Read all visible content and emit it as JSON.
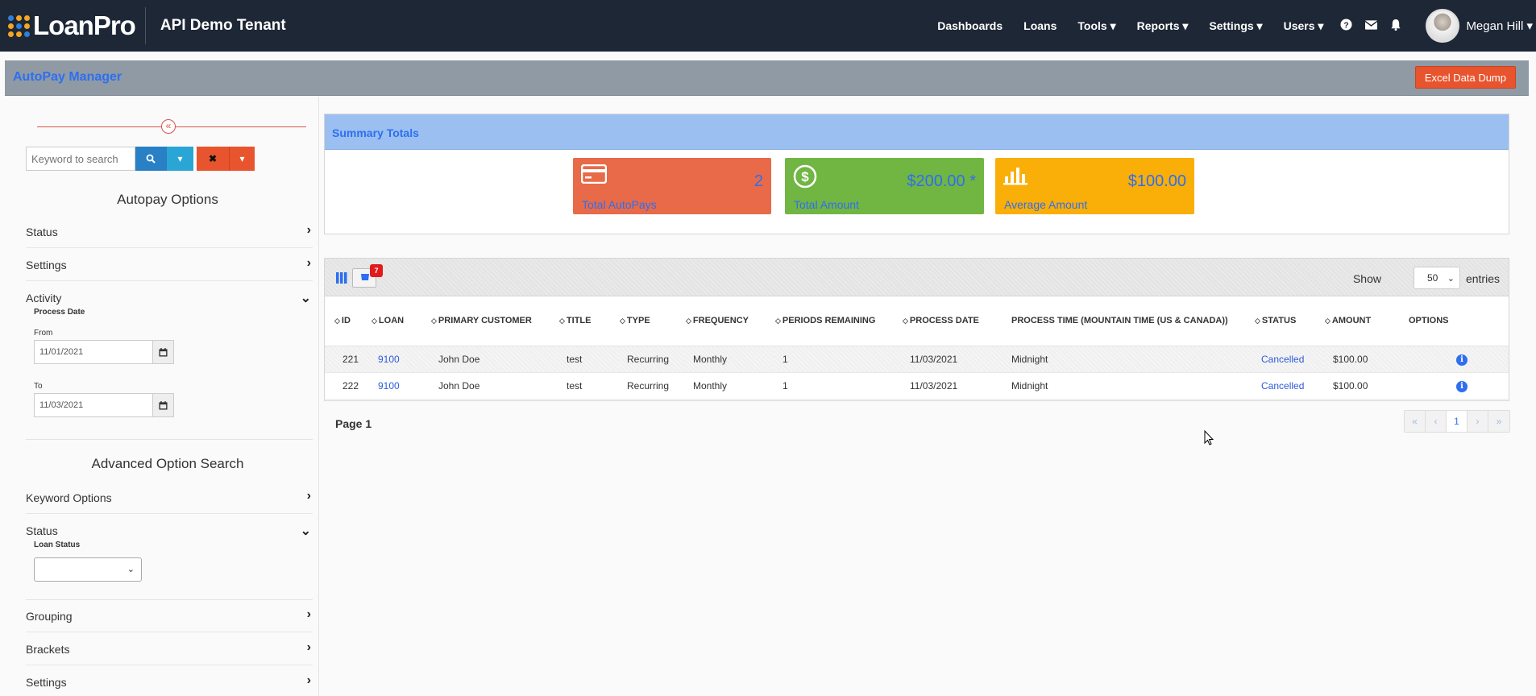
{
  "navbar": {
    "logo": "LoanPro",
    "tenant": "API Demo Tenant",
    "items": [
      "Dashboards",
      "Loans",
      "Tools ▾",
      "Reports ▾",
      "Settings ▾",
      "Users ▾"
    ],
    "icons": [
      "help-icon",
      "mail-icon",
      "bell-icon"
    ],
    "user": "Megan Hill ▾"
  },
  "page": {
    "title": "AutoPay Manager",
    "excel_button": "Excel Data Dump"
  },
  "sidebar": {
    "search_placeholder": "Keyword to search",
    "autopay_title": "Autopay Options",
    "status": "Status",
    "settings": "Settings",
    "activity": "Activity",
    "process_date": "Process Date",
    "from_label": "From",
    "from_value": "11/01/2021",
    "to_label": "To",
    "to_value": "11/03/2021",
    "advanced_title": "Advanced Option Search",
    "keyword_options": "Keyword Options",
    "status2": "Status",
    "loan_status": "Loan Status",
    "loan_status_value": "",
    "grouping": "Grouping",
    "brackets": "Brackets",
    "settings2": "Settings"
  },
  "summary": {
    "title": "Summary Totals",
    "cards": [
      {
        "value": "2",
        "label": "Total AutoPays",
        "icon": "credit-card-icon",
        "color": "#e86a48"
      },
      {
        "value": "$200.00 *",
        "label": "Total Amount",
        "icon": "dollar-icon",
        "color": "#71b543"
      },
      {
        "value": "$100.00",
        "label": "Average Amount",
        "icon": "bar-chart-icon",
        "color": "#f9ae08"
      }
    ]
  },
  "table": {
    "filter_count": "7",
    "show_label": "Show",
    "show_value": "50",
    "entries_label": "entries",
    "columns": [
      "ID",
      "LOAN",
      "PRIMARY CUSTOMER",
      "TITLE",
      "TYPE",
      "FREQUENCY",
      "PERIODS REMAINING",
      "PROCESS DATE",
      "PROCESS TIME (MOUNTAIN TIME (US & CANADA))",
      "STATUS",
      "AMOUNT",
      "OPTIONS"
    ],
    "rows": [
      {
        "id": "221",
        "loan": "9100",
        "customer": "John Doe",
        "title": "test",
        "type": "Recurring",
        "frequency": "Monthly",
        "periods": "1",
        "process_date": "11/03/2021",
        "process_time": "Midnight",
        "status": "Cancelled",
        "amount": "$100.00"
      },
      {
        "id": "222",
        "loan": "9100",
        "customer": "John Doe",
        "title": "test",
        "type": "Recurring",
        "frequency": "Monthly",
        "periods": "1",
        "process_date": "11/03/2021",
        "process_time": "Midnight",
        "status": "Cancelled",
        "amount": "$100.00"
      }
    ],
    "page_label": "Page 1",
    "pager": [
      "«",
      "‹",
      "1",
      "›",
      "»"
    ]
  }
}
